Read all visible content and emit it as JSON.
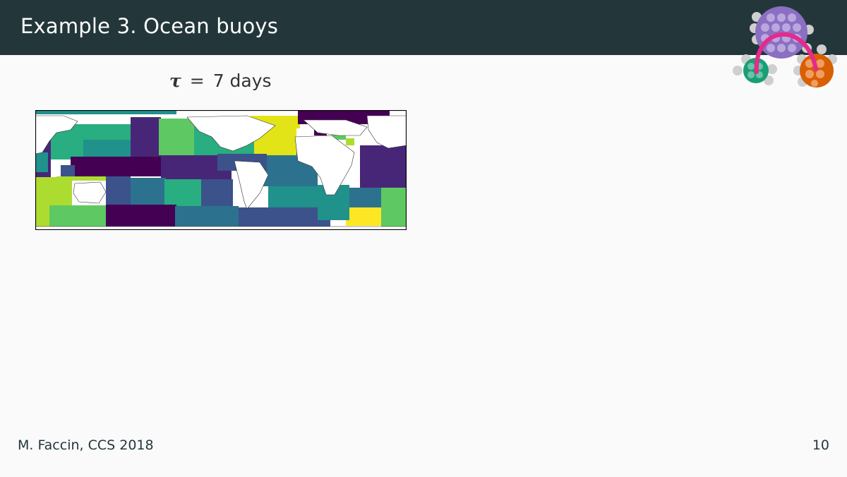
{
  "slide": {
    "title": "Example 3. Ocean buoys",
    "footer_author": "M. Faccin, CCS 2018",
    "page_number": "10"
  },
  "figure": {
    "tau_symbol": "τ",
    "equals": "=",
    "tau_value": "7 days"
  },
  "colors": {
    "header_bg": "#23373b",
    "background": "#fafafa",
    "logo_purple": "#8b6fc2",
    "logo_green": "#1a9e77",
    "logo_orange": "#d95f02",
    "logo_arc": "#e7298a",
    "viridis_dark_purple": "#440154",
    "viridis_indigo": "#482677",
    "viridis_blue": "#3b528b",
    "viridis_teal_blue": "#2c728e",
    "viridis_teal": "#21918c",
    "viridis_green": "#28ae80",
    "viridis_light_green": "#5ec962",
    "viridis_lime": "#addc30",
    "viridis_yellow": "#fde725"
  }
}
